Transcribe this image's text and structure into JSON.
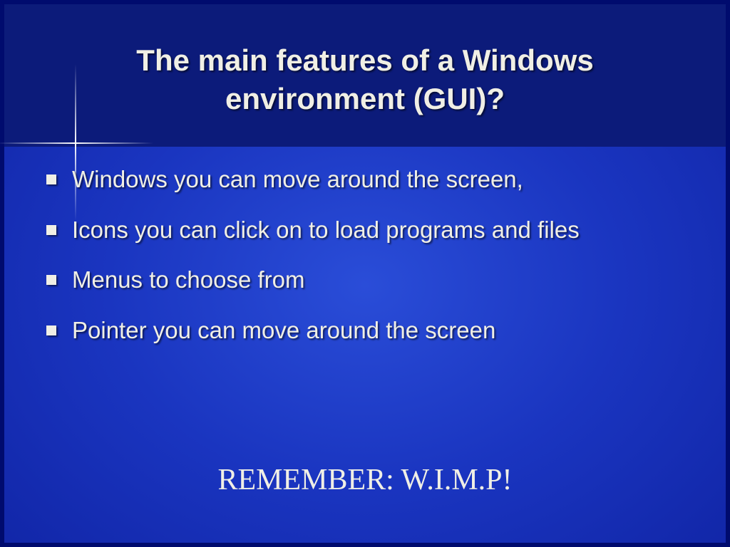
{
  "slide": {
    "title": "The main features of a Windows environment (GUI)?",
    "bullets": [
      "Windows you can move around the screen,",
      "Icons you can click on to load programs and files",
      "Menus to choose from",
      "Pointer you can move around the screen"
    ],
    "remember": "REMEMBER:  W.I.M.P!"
  }
}
